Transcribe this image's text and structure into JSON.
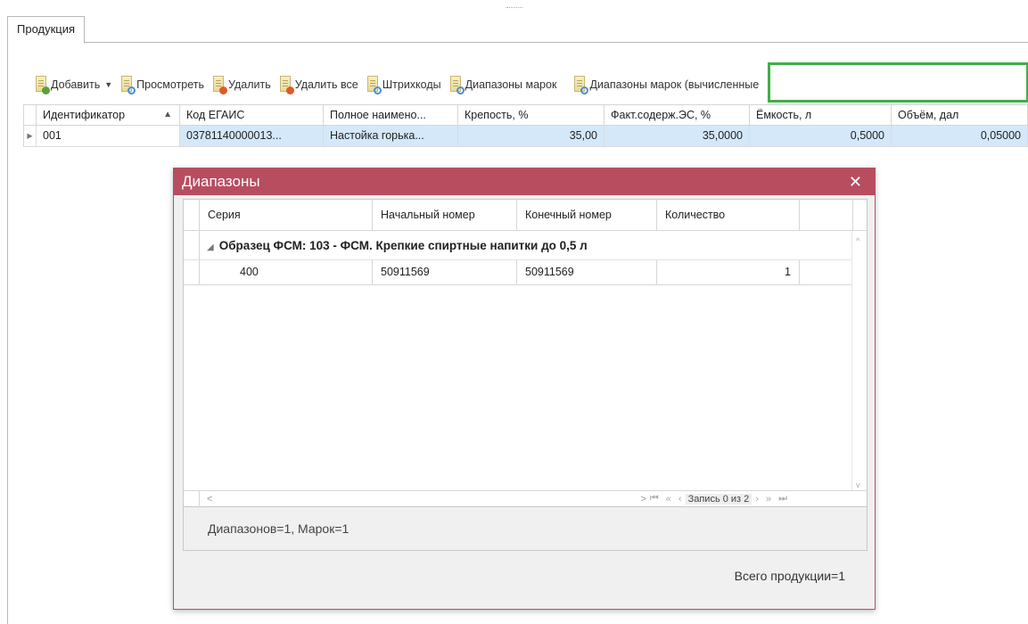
{
  "tab": {
    "label": "Продукция"
  },
  "toolbar": {
    "add": "Добавить",
    "view": "Просмотреть",
    "delete": "Удалить",
    "delete_all": "Удалить все",
    "barcodes": "Штрихкоды",
    "ranges": "Диапазоны марок",
    "ranges_calc": "Диапазоны марок (вычисленные"
  },
  "grid": {
    "headers": [
      "Идентификатор",
      "Код ЕГАИС",
      "Полное наимено...",
      "Крепость, %",
      "Факт.содерж.ЭС, %",
      "Ёмкость, л",
      "Объём, дал"
    ],
    "row": {
      "id": "001",
      "egais": "03781140000013...",
      "name": "Настойка горька...",
      "strength": "35,00",
      "actual": "35,0000",
      "capacity": "0,5000",
      "volume": "0,05000"
    }
  },
  "dialog": {
    "title": "Диапазоны",
    "headers": [
      "Серия",
      "Начальный номер",
      "Конечный номер",
      "Количество"
    ],
    "group": "Образец ФСМ: 103 - ФСМ. Крепкие спиртные напитки до 0,5 л",
    "row": {
      "series": "400",
      "start": "50911569",
      "end": "50911569",
      "count": "1"
    },
    "pager": "Запись 0 из 2",
    "status": "Диапазонов=1, Марок=1",
    "total": "Всего продукции=1"
  }
}
